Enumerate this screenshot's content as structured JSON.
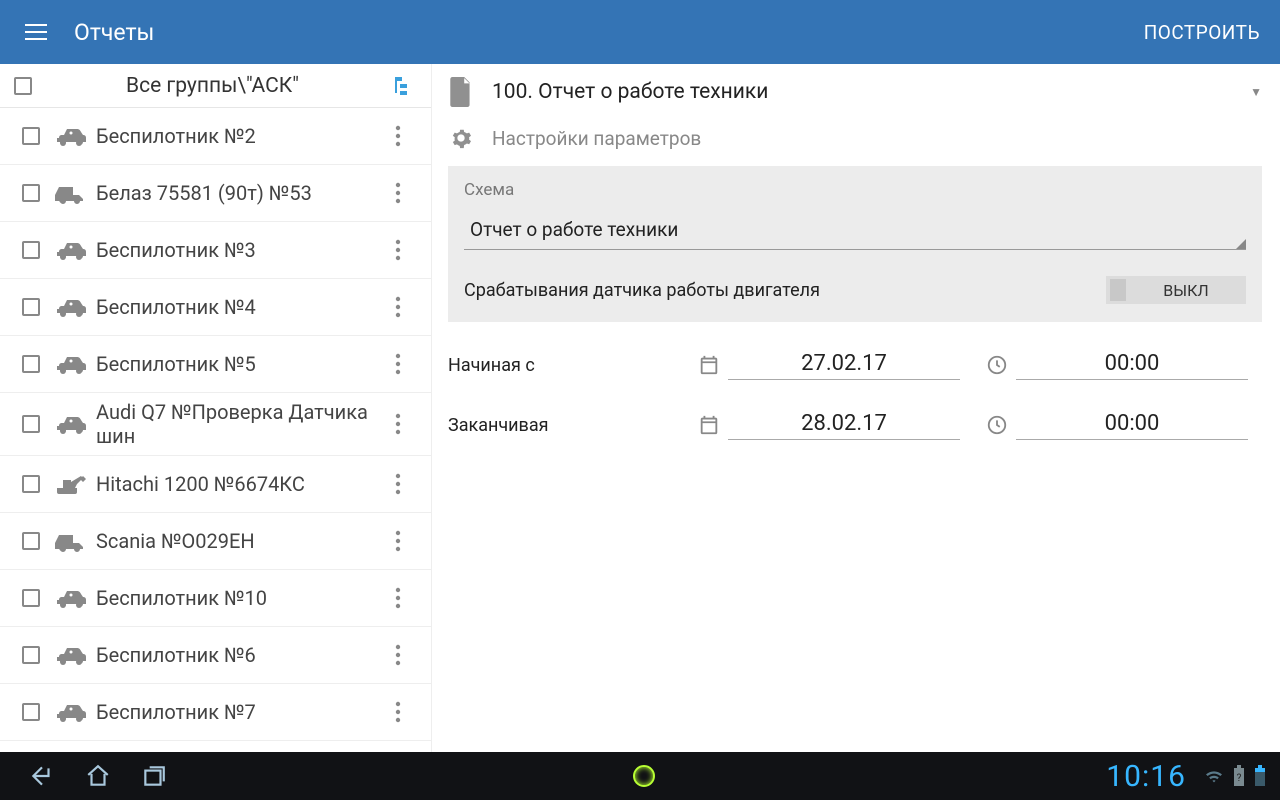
{
  "appbar": {
    "title": "Отчеты",
    "action": "ПОСТРОИТЬ"
  },
  "sidebar": {
    "group_label": "Все группы\\\"АСК\"",
    "vehicles": [
      {
        "label": "Беспилотник №2",
        "icon": "car"
      },
      {
        "label": "Белаз 75581 (90т) №53",
        "icon": "dump-truck"
      },
      {
        "label": "Беспилотник №3",
        "icon": "car"
      },
      {
        "label": "Беспилотник №4",
        "icon": "car"
      },
      {
        "label": "Беспилотник №5",
        "icon": "car"
      },
      {
        "label": "Audi Q7 №Проверка Датчика шин",
        "icon": "car"
      },
      {
        "label": "Hitachi 1200 №6674КС",
        "icon": "excavator"
      },
      {
        "label": "Scania №О029ЕН",
        "icon": "dump-truck"
      },
      {
        "label": "Беспилотник №10",
        "icon": "car"
      },
      {
        "label": "Беспилотник №6",
        "icon": "car"
      },
      {
        "label": "Беспилотник №7",
        "icon": "car"
      }
    ]
  },
  "report": {
    "title": "100. Отчет о работе техники",
    "params_label": "Настройки параметров",
    "scheme_label": "Схема",
    "scheme_value": "Отчет о работе техники",
    "sensor_label": "Срабатывания датчика работы двигателя",
    "sensor_toggle": "ВЫКЛ",
    "from_label": "Начиная с",
    "to_label": "Заканчивая",
    "from_date": "27.02.17",
    "from_time": "00:00",
    "to_date": "28.02.17",
    "to_time": "00:00"
  },
  "navbar": {
    "clock": "10:16"
  }
}
